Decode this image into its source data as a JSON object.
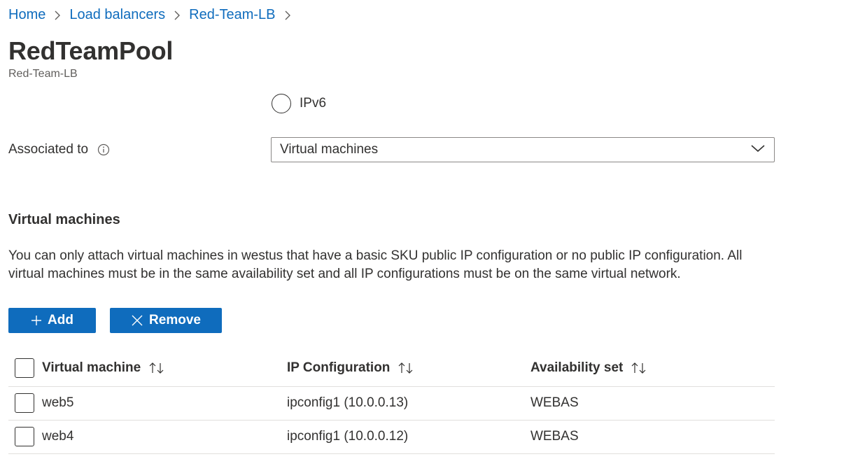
{
  "breadcrumb": {
    "items": [
      "Home",
      "Load balancers",
      "Red-Team-LB"
    ]
  },
  "header": {
    "title": "RedTeamPool",
    "subtitle": "Red-Team-LB"
  },
  "form": {
    "ip_version_option": "IPv6",
    "associated_to_label": "Associated to",
    "associated_to_value": "Virtual machines"
  },
  "vm_section": {
    "title": "Virtual machines",
    "description": "You can only attach virtual machines in westus that have a basic SKU public IP configuration or no public IP configuration. All virtual machines must be in the same availability set and all IP configurations must be on the same virtual network.",
    "add_label": "Add",
    "remove_label": "Remove"
  },
  "table": {
    "columns": [
      "Virtual machine",
      "IP Configuration",
      "Availability set"
    ],
    "rows": [
      {
        "vm": "web5",
        "ip": "ipconfig1 (10.0.0.13)",
        "availability": "WEBAS"
      },
      {
        "vm": "web4",
        "ip": "ipconfig1 (10.0.0.12)",
        "availability": "WEBAS"
      }
    ]
  },
  "icons": {
    "breadcrumb_separator": "chevron-right-icon",
    "info": "info-icon",
    "dropdown": "chevron-down-icon",
    "add": "plus-icon",
    "remove": "close-icon",
    "sort": "sort-icon"
  },
  "colors": {
    "accent": "#0f6cbd",
    "text": "#323130",
    "secondary_text": "#605e5c",
    "divider": "#e1dfdd"
  }
}
